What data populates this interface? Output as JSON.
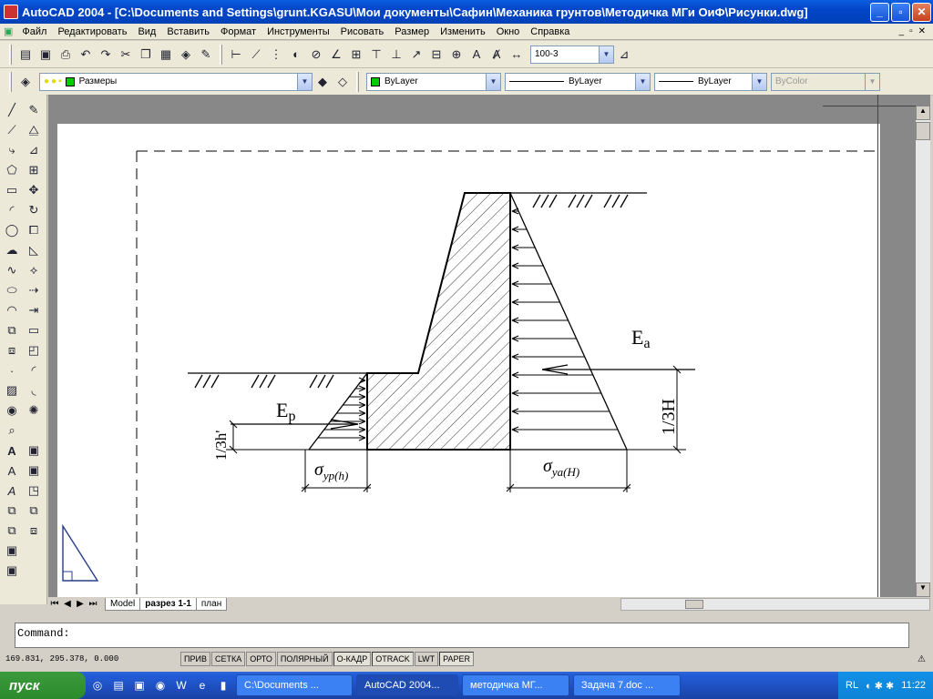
{
  "window": {
    "title": "AutoCAD 2004 - [C:\\Documents and Settings\\grunt.KGASU\\Мои документы\\Сафин\\Механика грунтов\\Методичка МГи ОиФ\\Рисунки.dwg]",
    "minimize": "_",
    "maximize": "▫",
    "close": "✕"
  },
  "menu": {
    "items": [
      "Файл",
      "Редактировать",
      "Вид",
      "Вставить",
      "Формат",
      "Инструменты",
      "Рисовать",
      "Размер",
      "Изменить",
      "Окно",
      "Справка"
    ],
    "mdi": [
      "_",
      "▫",
      "✕"
    ]
  },
  "toolbar": {
    "dimstyle": "100-3",
    "layer": "Размеры",
    "color": "ByLayer",
    "linetype": "ByLayer",
    "lineweight": "ByLayer",
    "plotstyle": "ByColor"
  },
  "drawing": {
    "label_ea": "E",
    "label_ea_sub": "a",
    "label_ep": "E",
    "label_ep_sub": "p",
    "dim_1_3h": "1/3H",
    "dim_1_3hp": "1/3h'",
    "sigma_left": "σ",
    "sigma_left_sub": "yp(h)",
    "sigma_right": "σ",
    "sigma_right_sub": "ya(H)"
  },
  "tabs": [
    "Model",
    "разрез 1-1",
    "план"
  ],
  "command": {
    "prompt": "Command:"
  },
  "status": {
    "coords": "169.831, 295.378, 0.000",
    "buttons": [
      "ПРИВ",
      "СЕТКА",
      "ОРТО",
      "ПОЛЯРНЫЙ",
      "О-КАДР",
      "OTRACK",
      "LWT",
      "PAPER"
    ]
  },
  "taskbar": {
    "start": "пуск",
    "tasks": [
      "C:\\Documents ...",
      "AutoCAD 2004...",
      "методичка МГ...",
      "Задача 7.doc ..."
    ],
    "lang": "RL",
    "clock": "11:22"
  }
}
